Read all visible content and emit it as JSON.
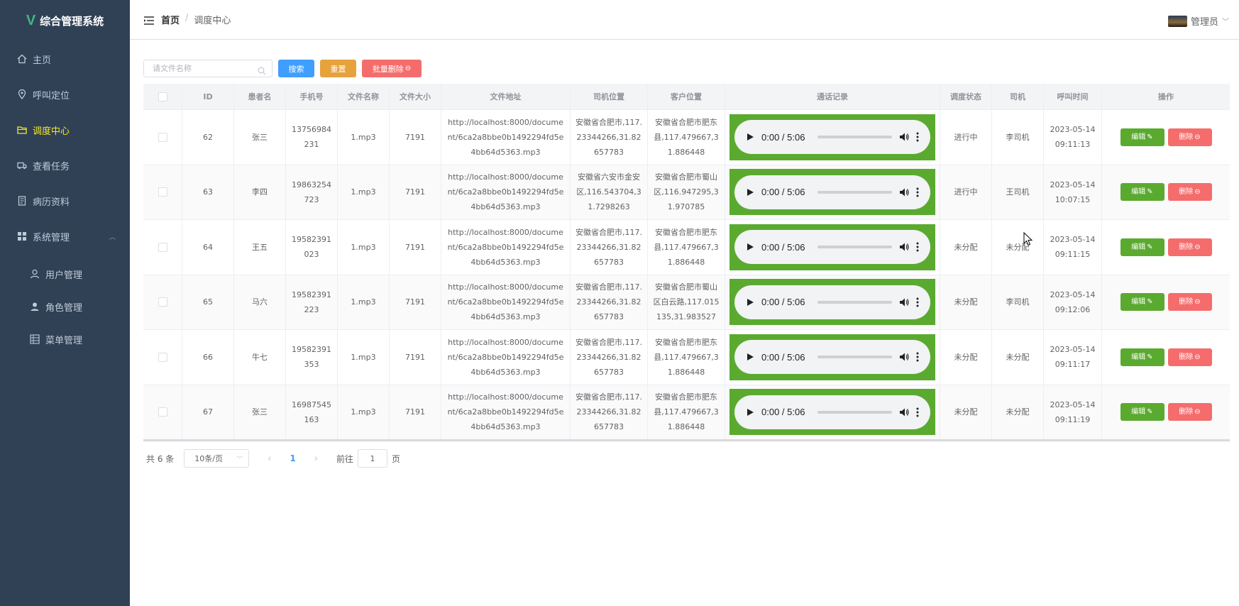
{
  "app": {
    "title": "综合管理系统"
  },
  "sidebar": {
    "items": [
      {
        "label": "主页",
        "icon": "home-icon"
      },
      {
        "label": "呼叫定位",
        "icon": "location-icon"
      },
      {
        "label": "调度中心",
        "icon": "folder-icon",
        "active": true
      },
      {
        "label": "查看任务",
        "icon": "truck-icon"
      },
      {
        "label": "病历资料",
        "icon": "document-icon"
      },
      {
        "label": "系统管理",
        "icon": "grid-icon",
        "expanded": true
      }
    ],
    "sub_items": [
      {
        "label": "用户管理",
        "icon": "user-icon"
      },
      {
        "label": "角色管理",
        "icon": "role-icon"
      },
      {
        "label": "菜单管理",
        "icon": "table-icon"
      }
    ],
    "active_color": "#f4e925"
  },
  "header": {
    "breadcrumb": {
      "home": "首页",
      "separator": "/",
      "current": "调度中心"
    },
    "user": "管理员"
  },
  "toolbar": {
    "search_placeholder": "请文件名称",
    "search_label": "搜索",
    "reset_label": "重置",
    "batch_delete_label": "批量删除"
  },
  "table": {
    "columns": [
      "ID",
      "患者名",
      "手机号",
      "文件名称",
      "文件大小",
      "文件地址",
      "司机位置",
      "客户位置",
      "通话记录",
      "调度状态",
      "司机",
      "呼叫时间",
      "操作"
    ],
    "rows": [
      {
        "id": "62",
        "name": "张三",
        "phone": "13756984231",
        "file": "1.mp3",
        "size": "7191",
        "addr": "http://localhost:8000/document/6ca2a8bbe0b1492294fd5e4bb64d5363.mp3",
        "driver_pos": "安徽省合肥市,117.23344266,31.82657783",
        "cust_pos": "安徽省合肥市肥东县,117.479667,31.886448",
        "audio_time": "0:00 / 5:06",
        "status": "进行中",
        "driver": "李司机",
        "date": "2023-05-14",
        "time": "09:11:13"
      },
      {
        "id": "63",
        "name": "李四",
        "phone": "19863254723",
        "file": "1.mp3",
        "size": "7191",
        "addr": "http://localhost:8000/document/6ca2a8bbe0b1492294fd5e4bb64d5363.mp3",
        "driver_pos": "安徽省六安市金安区,116.543704,31.7298263",
        "cust_pos": "安徽省合肥市蜀山区,116.947295,31.970785",
        "audio_time": "0:00 / 5:06",
        "status": "进行中",
        "driver": "王司机",
        "date": "2023-05-14",
        "time": "10:07:15"
      },
      {
        "id": "64",
        "name": "王五",
        "phone": "19582391023",
        "file": "1.mp3",
        "size": "7191",
        "addr": "http://localhost:8000/document/6ca2a8bbe0b1492294fd5e4bb64d5363.mp3",
        "driver_pos": "安徽省合肥市,117.23344266,31.82657783",
        "cust_pos": "安徽省合肥市肥东县,117.479667,31.886448",
        "audio_time": "0:00 / 5:06",
        "status": "未分配",
        "driver": "未分配",
        "date": "2023-05-14",
        "time": "09:11:15"
      },
      {
        "id": "65",
        "name": "马六",
        "phone": "19582391223",
        "file": "1.mp3",
        "size": "7191",
        "addr": "http://localhost:8000/document/6ca2a8bbe0b1492294fd5e4bb64d5363.mp3",
        "driver_pos": "安徽省合肥市,117.23344266,31.82657783",
        "cust_pos": "安徽省合肥市蜀山区白云路,117.015135,31.983527",
        "audio_time": "0:00 / 5:06",
        "status": "未分配",
        "driver": "李司机",
        "date": "2023-05-14",
        "time": "09:12:06"
      },
      {
        "id": "66",
        "name": "牛七",
        "phone": "19582391353",
        "file": "1.mp3",
        "size": "7191",
        "addr": "http://localhost:8000/document/6ca2a8bbe0b1492294fd5e4bb64d5363.mp3",
        "driver_pos": "安徽省合肥市,117.23344266,31.82657783",
        "cust_pos": "安徽省合肥市肥东县,117.479667,31.886448",
        "audio_time": "0:00 / 5:06",
        "status": "未分配",
        "driver": "未分配",
        "date": "2023-05-14",
        "time": "09:11:17"
      },
      {
        "id": "67",
        "name": "张三",
        "phone": "16987545163",
        "file": "1.mp3",
        "size": "7191",
        "addr": "http://localhost:8000/document/6ca2a8bbe0b1492294fd5e4bb64d5363.mp3",
        "driver_pos": "安徽省合肥市,117.23344266,31.82657783",
        "cust_pos": "安徽省合肥市肥东县,117.479667,31.886448",
        "audio_time": "0:00 / 5:06",
        "status": "未分配",
        "driver": "未分配",
        "date": "2023-05-14",
        "time": "09:11:19"
      }
    ],
    "edit_label": "编辑",
    "delete_label": "删除"
  },
  "pagination": {
    "total": "共 6 条",
    "page_size": "10条/页",
    "current_page": "1",
    "goto_label": "前往",
    "goto_value": "1",
    "page_suffix": "页"
  },
  "colors": {
    "sidebar_bg": "#304156",
    "primary": "#409eff",
    "warning": "#e6a23c",
    "danger": "#f56c6c",
    "success": "#5aaa2f"
  }
}
